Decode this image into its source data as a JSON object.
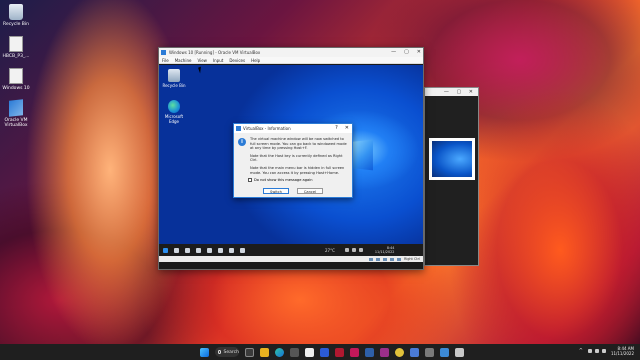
{
  "desktop": {
    "icons": [
      {
        "label": "Recycle Bin",
        "icon": "recycle-bin-icon"
      },
      {
        "label": "HBCB_P3_...",
        "icon": "file-icon"
      },
      {
        "label": "Windows 10",
        "icon": "file-icon"
      },
      {
        "label": "Oracle VM VirtualBox",
        "icon": "virtualbox-icon"
      }
    ]
  },
  "vm_window": {
    "title": "Windows 10 [Running] - Oracle VM VirtualBox",
    "menu": [
      "File",
      "Machine",
      "View",
      "Input",
      "Devices",
      "Help"
    ],
    "guest_icons": [
      {
        "label": "Recycle Bin",
        "icon": "recycle-bin-icon"
      },
      {
        "label": "Microsoft Edge",
        "icon": "edge-icon"
      }
    ],
    "guest_taskbar": {
      "weather": "27°C",
      "time": "8:44",
      "date": "11/11/2022"
    },
    "statusbar": {
      "host_key": "Right Ctrl"
    }
  },
  "dialog": {
    "title": "VirtualBox - Information",
    "paragraphs": [
      "The virtual machine window will be now switched to full screen mode. You can go back to windowed mode at any time by pressing Host+F.",
      "Note that the Host key is currently defined as Right Ctrl.",
      "Note that the main menu bar is hidden in full screen mode. You can access it by pressing Host+Home."
    ],
    "checkbox_label": "Do not show this message again",
    "buttons": {
      "primary": "Switch",
      "secondary": "Cancel"
    }
  },
  "taskbar": {
    "search_label": "Search",
    "time": "8:44 AM",
    "date": "11/11/2022"
  },
  "colors": {
    "accent": "#2b7bd6",
    "taskbar": "#1f1f1f"
  }
}
